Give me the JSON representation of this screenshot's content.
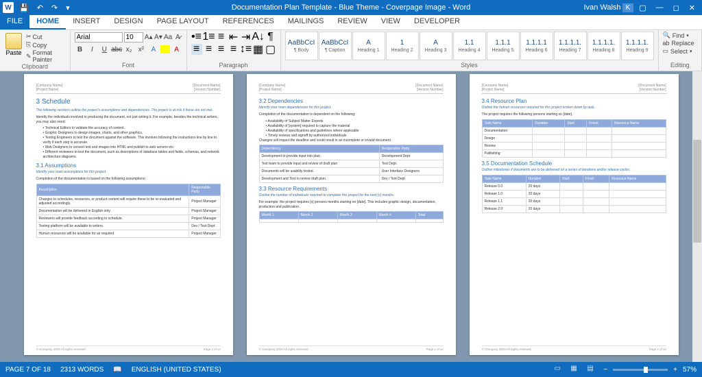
{
  "title": "Documentation Plan Template - Blue Theme - Coverpage Image - Word",
  "user": "Ivan Walsh",
  "qat": [
    "save-icon",
    "undo-icon",
    "redo-icon"
  ],
  "tabs": [
    "FILE",
    "HOME",
    "INSERT",
    "DESIGN",
    "PAGE LAYOUT",
    "REFERENCES",
    "MAILINGS",
    "REVIEW",
    "VIEW",
    "DEVELOPER"
  ],
  "active_tab": 1,
  "ribbon": {
    "clipboard": {
      "label": "Clipboard",
      "paste": "Paste",
      "cut": "Cut",
      "copy": "Copy",
      "format": "Format Painter"
    },
    "font": {
      "label": "Font",
      "name": "Arial",
      "size": "10",
      "buttons": [
        "B",
        "I",
        "U",
        "abc",
        "x₂",
        "x²"
      ]
    },
    "paragraph": {
      "label": "Paragraph"
    },
    "styles": {
      "label": "Styles",
      "items": [
        {
          "preview": "AaBbCcI",
          "name": "¶ Body"
        },
        {
          "preview": "AaBbCcI",
          "name": "¶ Caption"
        },
        {
          "preview": "A",
          "name": "Heading 1"
        },
        {
          "preview": "1",
          "name": "Heading 2"
        },
        {
          "preview": "A",
          "name": "Heading 3"
        },
        {
          "preview": "1.1",
          "name": "Heading 4"
        },
        {
          "preview": "1.1.1",
          "name": "Heading 5"
        },
        {
          "preview": "1.1.1.1",
          "name": "Heading 6"
        },
        {
          "preview": "1.1.1.1.",
          "name": "Heading 7"
        },
        {
          "preview": "1.1.1.1.",
          "name": "Heading 8"
        },
        {
          "preview": "1.1.1.1.",
          "name": "Heading 9"
        }
      ]
    },
    "editing": {
      "label": "Editing",
      "find": "Find",
      "replace": "Replace",
      "select": "Select"
    }
  },
  "pages": {
    "p1": {
      "header_left": "[Company Name]\n[Project Name]",
      "header_right": "[Document Name]\n[Version Number]",
      "h": "3    Schedule",
      "note": "The following sections outline the project's assumptions and dependencies. The project is at risk if these are not met.",
      "intro": "Identify the individuals involved in producing the document, not just writing it. For example, besides the technical writers, you may also need:",
      "bullets": [
        "Technical Editors to validate the accuracy of content.",
        "Graphic Designers to design images, charts, and other graphics.",
        "Testing Engineers to test the document against the software. This involves following the instructions line by line to verify if each step is accurate.",
        "Web Designers to convert text and images into HTML and publish to web servers etc.",
        "Different reviewers to test the document, such as descriptions of database tables and fields, schemas, and network architecture diagrams."
      ],
      "h2": "3.1    Assumptions",
      "note2": "Identify your main assumptions for this project.",
      "intro2": "Completion of the documentation is based on the following assumptions:",
      "table_h": [
        "Assumption",
        "Responsible Party"
      ],
      "table": [
        [
          "Changes to schedules, resources, or product content will require these to be re-evaluated and adjusted accordingly.",
          "Project Manager"
        ],
        [
          "Documentation will be delivered in English only.",
          "Project Manager"
        ],
        [
          "Reviewers will provide feedback according to schedule.",
          "Project Manager"
        ],
        [
          "Testing platform will be available to writers.",
          "Dev / Test Dept"
        ],
        [
          "Human resources will be available for as required",
          "Project Manager"
        ]
      ]
    },
    "p2": {
      "h": "3.2    Dependencies",
      "note": "Identify your main dependencies for this project.",
      "intro": "Completion of the documentation is dependent on the following:",
      "bullets": [
        "Availability of Subject Matter Experts",
        "Availability of [system] required to capture the material",
        "Availability of specifications and guidelines where applicable",
        "Timely reviews and signoff by authorized individuals"
      ],
      "intro2": "Changes will impact the deadline and could result in an incomplete or invalid document.",
      "table_h": [
        "Dependency",
        "Responsible Party"
      ],
      "table": [
        [
          "Development to provide input into plan",
          "Development Dept"
        ],
        [
          "Test team to provide input and review of draft plan",
          "Test Dept."
        ],
        [
          "Documents will be usability tested.",
          "User Interface Designers"
        ],
        [
          "Development and Test to review draft plan.",
          "Dev / Test Dept"
        ]
      ],
      "h2": "3.3    Resource Requirements",
      "note2": "Outline the number of individuals required to complete this project for the next [x] months.",
      "intro3": "For example: the project requires [x] persons months starting on [date]. This includes graphic design, documentation, production and publication.",
      "table2_h": [
        "Month 1",
        "Month 2",
        "Month 3",
        "Month 4",
        "Total"
      ]
    },
    "p3": {
      "h": "3.4    Resource Plan",
      "note": "Outline the human resources required for this project broken down by task.",
      "intro": "The project requires the following persons starting on [date].",
      "table_h": [
        "Task Name",
        "Duration",
        "Start",
        "Finish",
        "Resource Name"
      ],
      "table_rows": [
        "Documentation",
        "Design",
        "Review",
        "Publishing"
      ],
      "h2": "3.5    Documentation Schedule",
      "note2": "Outline milestones if documents are to be delivered on a series of iterations and/or release cycles.",
      "table2_h": [
        "Task Name",
        "Duration",
        "Start",
        "Finish",
        "Resource Name"
      ],
      "table2": [
        [
          "Release 0.0",
          "20 days",
          "",
          "",
          ""
        ],
        [
          "Release 1.0",
          "20 days",
          "",
          "",
          ""
        ],
        [
          "Release 1.1",
          "20 days",
          "",
          "",
          ""
        ],
        [
          "Release 2.0",
          "20 days",
          "",
          "",
          ""
        ]
      ]
    }
  },
  "status": {
    "page": "PAGE 7 OF 18",
    "words": "2313 WORDS",
    "lang": "ENGLISH (UNITED STATES)",
    "zoom": "57%"
  }
}
